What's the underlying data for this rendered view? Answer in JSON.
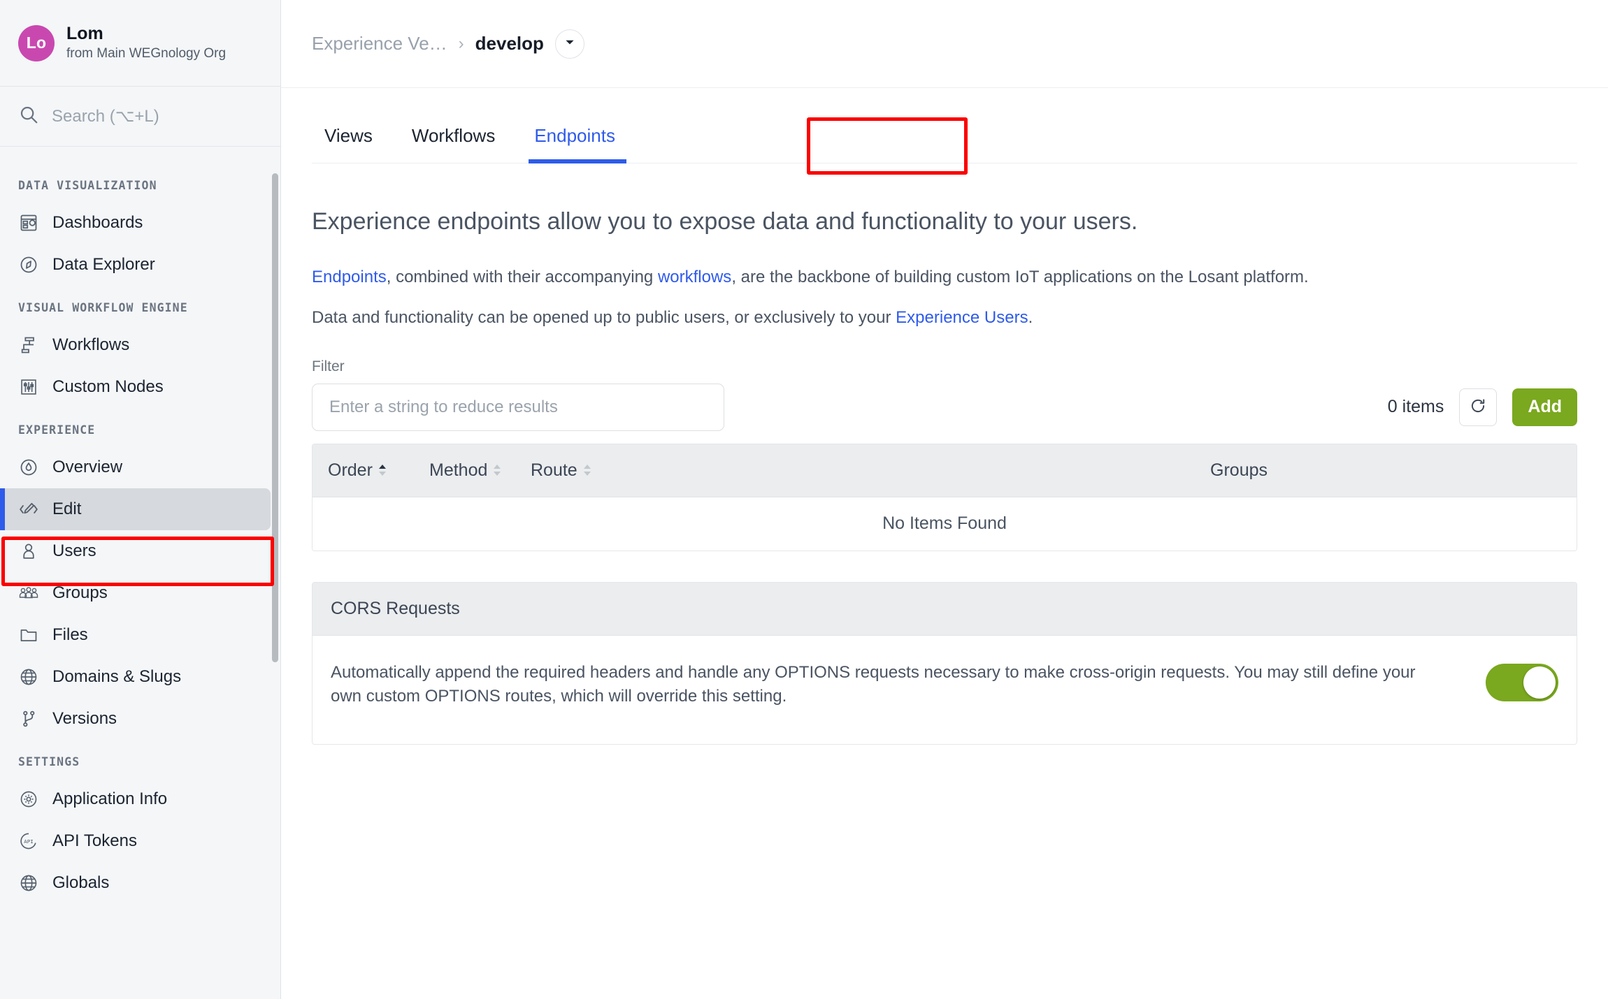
{
  "sidebar": {
    "org": {
      "avatar_initials": "Lo",
      "name": "Lom",
      "subtitle": "from Main WEGnology Org"
    },
    "search": {
      "placeholder": "Search (⌥+L)",
      "icon": "search-icon"
    },
    "sections": [
      {
        "title": "DATA VISUALIZATION",
        "items": [
          {
            "label": "Dashboards",
            "icon": "dashboards-icon",
            "active": false
          },
          {
            "label": "Data Explorer",
            "icon": "compass-icon",
            "active": false
          }
        ]
      },
      {
        "title": "VISUAL WORKFLOW ENGINE",
        "items": [
          {
            "label": "Workflows",
            "icon": "workflow-icon",
            "active": false
          },
          {
            "label": "Custom Nodes",
            "icon": "sliders-icon",
            "active": false
          }
        ]
      },
      {
        "title": "EXPERIENCE",
        "items": [
          {
            "label": "Overview",
            "icon": "droplet-icon",
            "active": false
          },
          {
            "label": "Edit",
            "icon": "code-pencil-icon",
            "active": true
          },
          {
            "label": "Users",
            "icon": "user-icon",
            "active": false
          },
          {
            "label": "Groups",
            "icon": "users-group-icon",
            "active": false
          },
          {
            "label": "Files",
            "icon": "folder-icon",
            "active": false
          },
          {
            "label": "Domains & Slugs",
            "icon": "www-globe-icon",
            "active": false
          },
          {
            "label": "Versions",
            "icon": "branch-icon",
            "active": false
          }
        ]
      },
      {
        "title": "SETTINGS",
        "items": [
          {
            "label": "Application Info",
            "icon": "gear-icon",
            "active": false
          },
          {
            "label": "API Tokens",
            "icon": "api-token-icon",
            "active": false
          },
          {
            "label": "Globals",
            "icon": "globe-icon",
            "active": false
          }
        ]
      }
    ]
  },
  "breadcrumb": {
    "parent": "Experience Ve…",
    "separator": "›",
    "current": "develop",
    "dropdown_icon": "chevron-down-icon"
  },
  "tabs": [
    {
      "label": "Views",
      "active": false
    },
    {
      "label": "Workflows",
      "active": false
    },
    {
      "label": "Endpoints",
      "active": true
    }
  ],
  "main": {
    "lede": "Experience endpoints allow you to expose data and functionality to your users.",
    "paragraph1": {
      "link1": "Endpoints",
      "mid": ", combined with their accompanying ",
      "link2": "workflows",
      "tail": ", are the backbone of building custom IoT applications on the Losant platform."
    },
    "paragraph2": {
      "head": "Data and functionality can be opened up to public users, or exclusively to your ",
      "link": "Experience Users",
      "tail": "."
    },
    "filter": {
      "label": "Filter",
      "placeholder": "Enter a string to reduce results",
      "value": ""
    },
    "items_count": "0 items",
    "refresh_icon": "refresh-icon",
    "add_label": "Add",
    "table": {
      "columns": [
        {
          "label": "Order",
          "sortable": true,
          "sort": "asc"
        },
        {
          "label": "Method",
          "sortable": true,
          "sort": "none"
        },
        {
          "label": "Route",
          "sortable": true,
          "sort": "none"
        },
        {
          "label": "Groups",
          "sortable": false,
          "sort": "none"
        }
      ],
      "rows": [],
      "empty_text": "No Items Found"
    },
    "cors": {
      "title": "CORS Requests",
      "description": "Automatically append the required headers and handle any OPTIONS requests necessary to make cross-origin requests. You may still define your own custom OPTIONS routes, which will override this setting.",
      "toggle_on": true
    }
  },
  "colors": {
    "accent_blue": "#2f5bea",
    "green": "#7aa81e",
    "avatar_magenta": "#c948b0",
    "annotation_red": "#fb0000",
    "sidebar_bg": "#f4f6f8",
    "header_gray": "#ebedef"
  }
}
